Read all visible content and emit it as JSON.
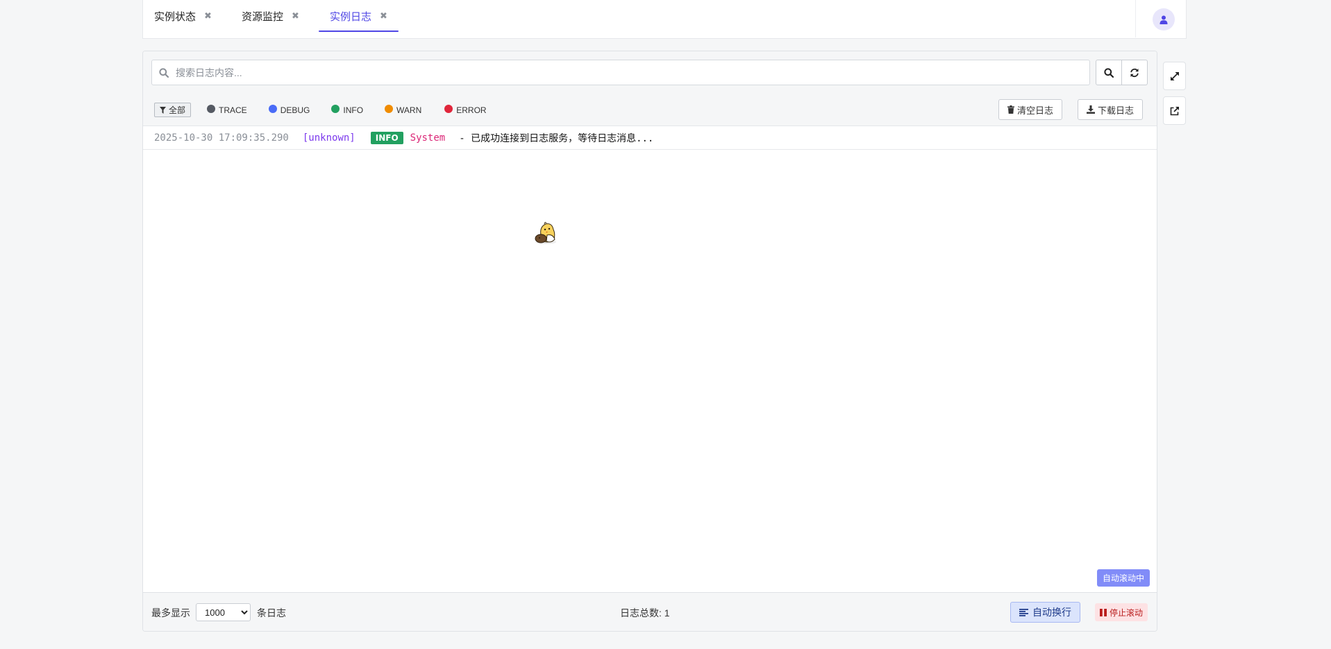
{
  "tabs": [
    {
      "label": "实例状态",
      "active": false
    },
    {
      "label": "资源监控",
      "active": false
    },
    {
      "label": "实例日志",
      "active": true
    }
  ],
  "user": {
    "icon": "user-icon"
  },
  "search": {
    "placeholder": "搜索日志内容...",
    "value": ""
  },
  "filters": {
    "all_label": "全部",
    "levels": [
      {
        "label": "TRACE",
        "color": "#555a63"
      },
      {
        "label": "DEBUG",
        "color": "#4a6cf7"
      },
      {
        "label": "INFO",
        "color": "#22a060"
      },
      {
        "label": "WARN",
        "color": "#f08c00"
      },
      {
        "label": "ERROR",
        "color": "#e0263b"
      }
    ]
  },
  "actions": {
    "clear_label": "清空日志",
    "download_label": "下载日志"
  },
  "logs": [
    {
      "time": "2025-10-30 17:09:35.290",
      "thread": "[unknown]",
      "level": "INFO",
      "source": "System",
      "message": "- 已成功连接到日志服务，等待日志消息..."
    }
  ],
  "status": {
    "autoscroll_badge": "自动滚动中"
  },
  "footer": {
    "max_show_label": "最多显示",
    "max_show_value": "1000",
    "max_show_options": [
      "1000"
    ],
    "unit_label": "条日志",
    "total_label": "日志总数: 1",
    "wrap_label": "自动换行",
    "stop_label": "停止滚动"
  },
  "colors": {
    "accent": "#4f46e5",
    "info": "#22a060",
    "thread": "#7c3aed",
    "source": "#db2777"
  }
}
